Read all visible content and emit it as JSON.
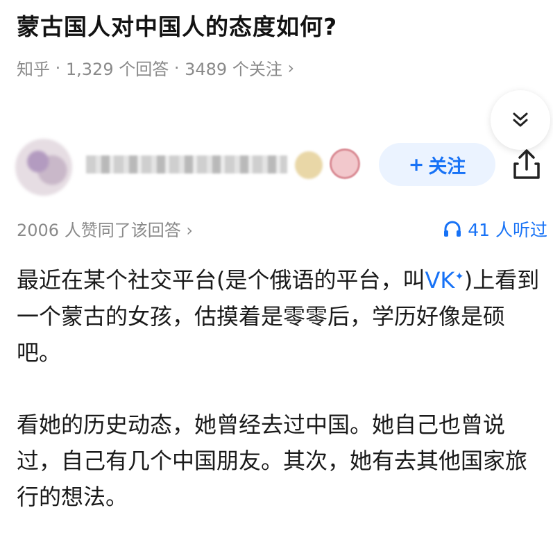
{
  "question": {
    "title": "蒙古国人对中国人的态度如何?",
    "source": "知乎",
    "sep": " · ",
    "answers": "1,329 个回答",
    "followers": "3489 个关注",
    "arrow": " ›"
  },
  "author": {
    "follow_label": "关注",
    "follow_plus": "+"
  },
  "answer_meta": {
    "votes": "2006 人赞同了该回答 ›",
    "listen": "41 人听过"
  },
  "body": {
    "p1_a": "最近在某个社交平台(是个俄语的平台，叫",
    "p1_link": "VK",
    "p1_link_sup": "✦",
    "p1_b": ")上看到一个蒙古的女孩，估摸着是零零后，学历好像是硕吧。",
    "p2": "看她的历史动态，她曾经去过中国。她自己也曾说过，自己有几个中国朋友。其次，她有去其他国家旅行的想法。"
  },
  "icons": [
    "chevron-double-down-icon",
    "share-icon",
    "headphones-icon",
    "plus-icon"
  ],
  "colors": {
    "accent": "#1772f6",
    "follow_bg": "#ebf3ff",
    "meta": "#8a8a8a"
  }
}
